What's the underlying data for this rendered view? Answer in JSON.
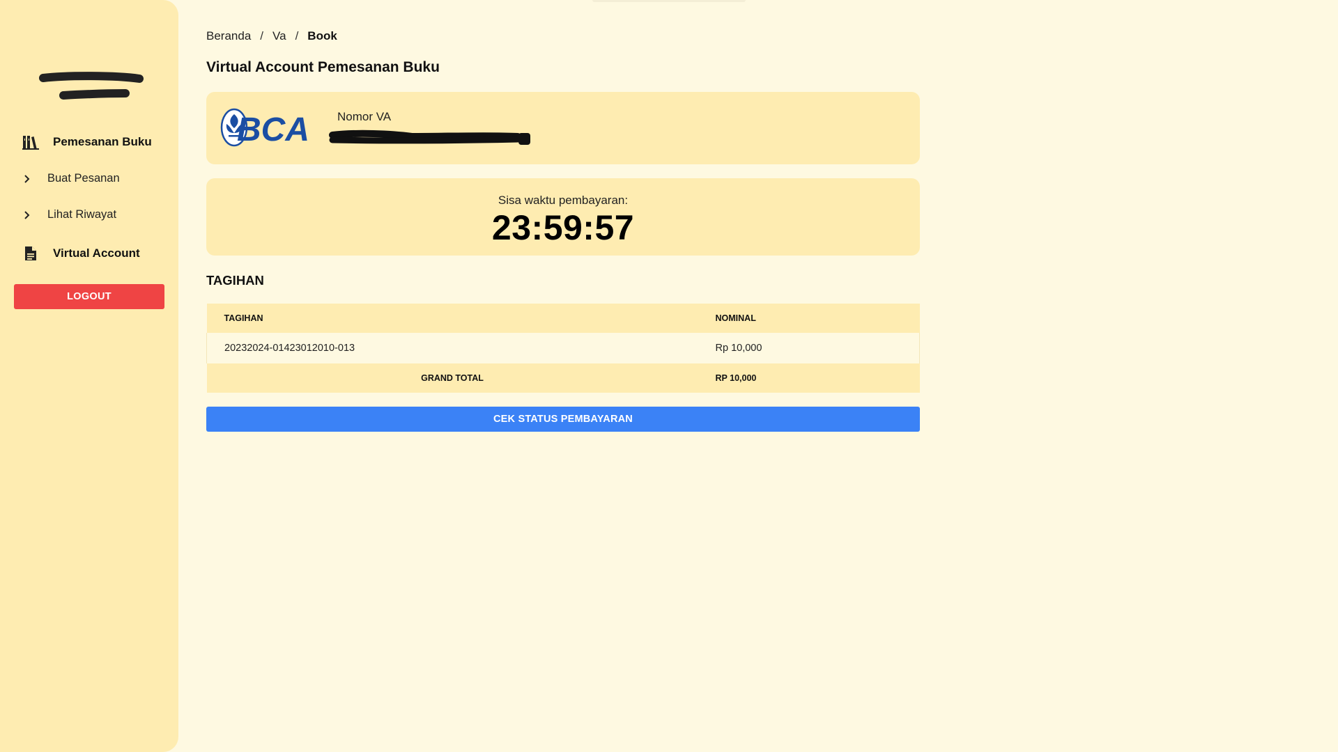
{
  "sidebar": {
    "section_orders": "Pemesanan Buku",
    "item_create": "Buat Pesanan",
    "item_history": "Lihat Riwayat",
    "section_va": "Virtual Account",
    "logout": "LOGOUT"
  },
  "breadcrumb": {
    "home": "Beranda",
    "sep1": "/",
    "va": "Va",
    "sep2": "/",
    "current": "Book"
  },
  "page_title": "Virtual Account Pemesanan Buku",
  "va_card": {
    "bank": "BCA",
    "label": "Nomor VA"
  },
  "timer": {
    "label": "Sisa waktu pembayaran:",
    "value": "23:59:57"
  },
  "bill": {
    "section_title": "TAGIHAN",
    "headers": {
      "tagihan": "TAGIHAN",
      "nominal": "NOMINAL"
    },
    "rows": [
      {
        "tagihan": "20232024-01423012010-013",
        "nominal": "Rp 10,000"
      }
    ],
    "grand_total_label": "GRAND TOTAL",
    "grand_total_value": "RP 10,000"
  },
  "check_button": "CEK STATUS PEMBAYARAN",
  "colors": {
    "sidebar_bg": "#feecb1",
    "page_bg": "#fef9e1",
    "logout": "#ef4444",
    "primary": "#3b82f6",
    "bca_blue": "#1b4ea3"
  },
  "icons": {
    "orders": "book-library-icon",
    "va": "document-icon",
    "chevron": "chevron-right-icon"
  }
}
